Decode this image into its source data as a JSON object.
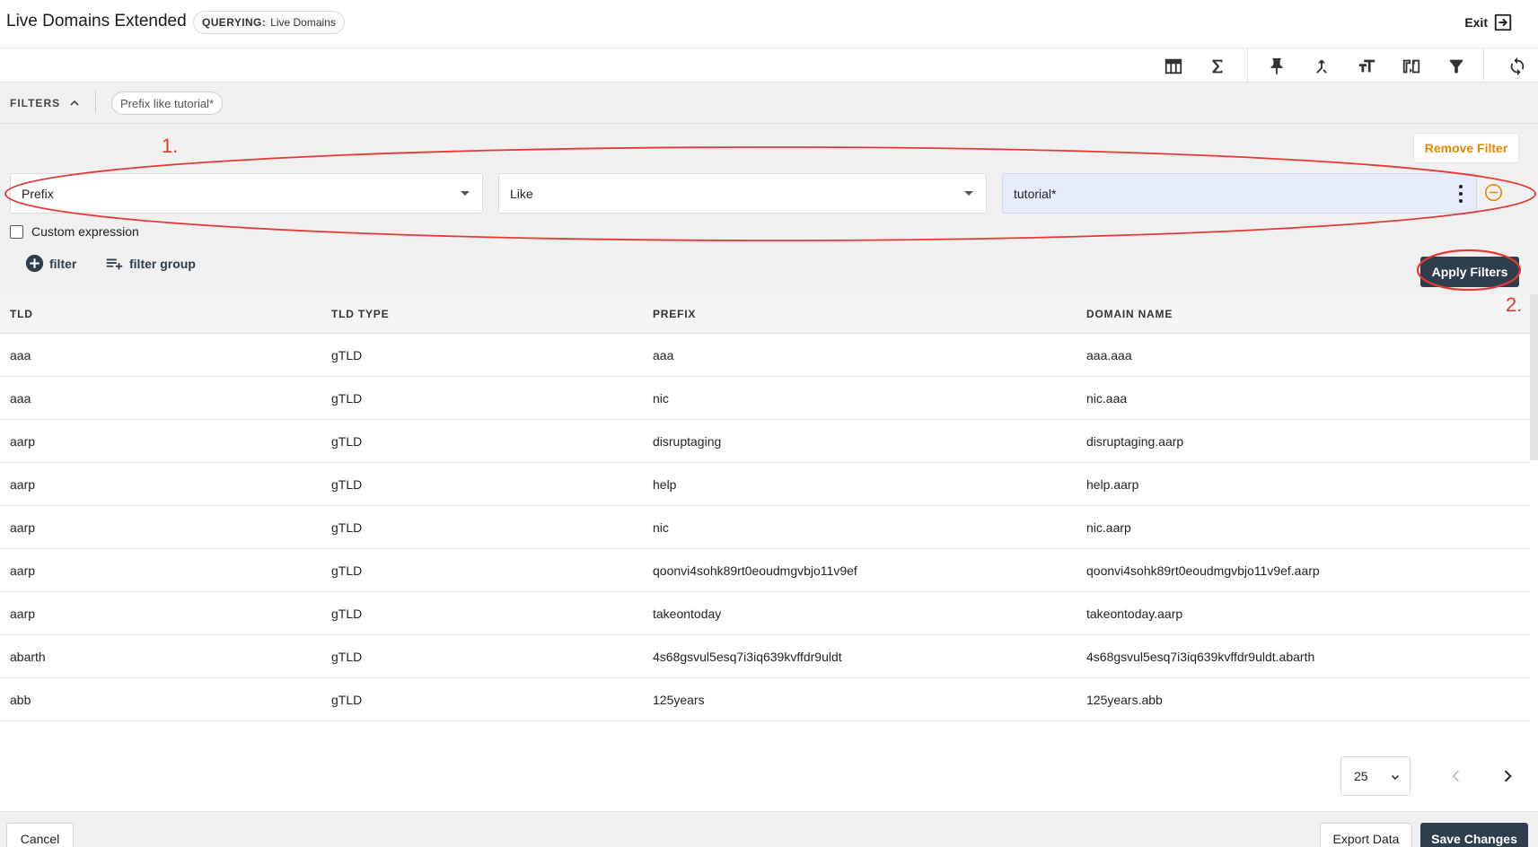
{
  "header": {
    "title": "Live Domains Extended",
    "querying_label": "QUERYING:",
    "querying_value": "Live Domains",
    "exit_label": "Exit"
  },
  "toolbar": {
    "icons": [
      "table-columns-icon",
      "sigma-icon",
      "pin-icon",
      "merge-icon",
      "text-size-icon",
      "swap-icon",
      "funnel-icon",
      "refresh-icon"
    ]
  },
  "filters": {
    "label": "FILTERS",
    "chip": "Prefix like tutorial*",
    "remove_label": "Remove Filter",
    "field": "Prefix",
    "operator": "Like",
    "value": "tutorial*",
    "custom_expression_label": "Custom expression",
    "add_filter_label": "filter",
    "add_group_label": "filter group",
    "apply_label": "Apply Filters"
  },
  "annotations": {
    "step1": "1.",
    "step2": "2.",
    "color": "#e53935"
  },
  "table": {
    "columns": [
      "TLD",
      "TLD TYPE",
      "PREFIX",
      "DOMAIN NAME"
    ],
    "rows": [
      [
        "aaa",
        "gTLD",
        "aaa",
        "aaa.aaa"
      ],
      [
        "aaa",
        "gTLD",
        "nic",
        "nic.aaa"
      ],
      [
        "aarp",
        "gTLD",
        "disruptaging",
        "disruptaging.aarp"
      ],
      [
        "aarp",
        "gTLD",
        "help",
        "help.aarp"
      ],
      [
        "aarp",
        "gTLD",
        "nic",
        "nic.aarp"
      ],
      [
        "aarp",
        "gTLD",
        "qoonvi4sohk89rt0eoudmgvbjo11v9ef",
        "qoonvi4sohk89rt0eoudmgvbjo11v9ef.aarp"
      ],
      [
        "aarp",
        "gTLD",
        "takeontoday",
        "takeontoday.aarp"
      ],
      [
        "abarth",
        "gTLD",
        "4s68gsvul5esq7i3iq639kvffdr9uldt",
        "4s68gsvul5esq7i3iq639kvffdr9uldt.abarth"
      ],
      [
        "abb",
        "gTLD",
        "125years",
        "125years.abb"
      ]
    ]
  },
  "pagination": {
    "page_size": "25"
  },
  "footer": {
    "cancel_label": "Cancel",
    "export_label": "Export Data",
    "save_label": "Save Changes"
  },
  "colors": {
    "primary": "#2f3e4d",
    "warning": "#e08a00",
    "value_bg": "#e6ecfa"
  }
}
